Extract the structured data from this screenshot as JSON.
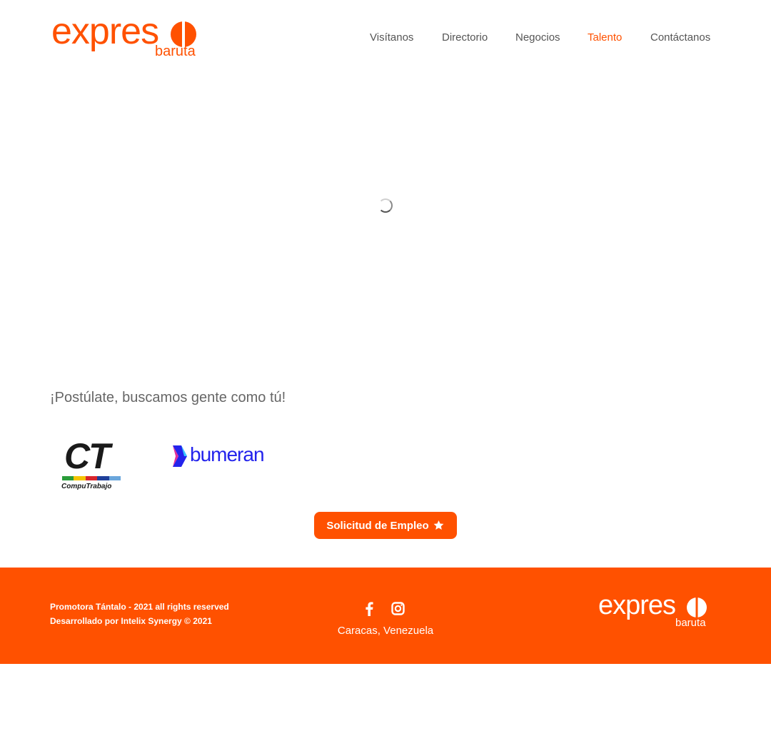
{
  "brand": {
    "wordmark": "expres",
    "sub": "baruta",
    "color": "#ff5100"
  },
  "nav": {
    "items": [
      {
        "label": "Visítanos"
      },
      {
        "label": "Directorio"
      },
      {
        "label": "Negocios"
      },
      {
        "label": "Talento",
        "active": true
      },
      {
        "label": "Contáctanos"
      }
    ]
  },
  "main": {
    "loading_indicator": "spinner-icon",
    "heading": "¡Postúlate, buscamos gente como tú!",
    "partners": [
      {
        "letters": "CT",
        "name": "CompuTrabajo",
        "stripe_colors": [
          "#2a9c3a",
          "#f5c400",
          "#d9262c",
          "#1f3f9a",
          "#6aa6dc"
        ]
      },
      {
        "name": "bumeran",
        "color": "#2323ec"
      }
    ],
    "cta": {
      "label": "Solicitud de Empleo",
      "icon": "star-icon"
    }
  },
  "footer": {
    "copyright": "Promotora Tántalo - 2021 all rights reserved",
    "developer": "Desarrollado por Intelix Synergy © 2021",
    "social": [
      "facebook-icon",
      "instagram-icon"
    ],
    "location": "Caracas, Venezuela",
    "logo_wordmark": "expres",
    "logo_sub": "baruta",
    "background": "#ff5100"
  }
}
